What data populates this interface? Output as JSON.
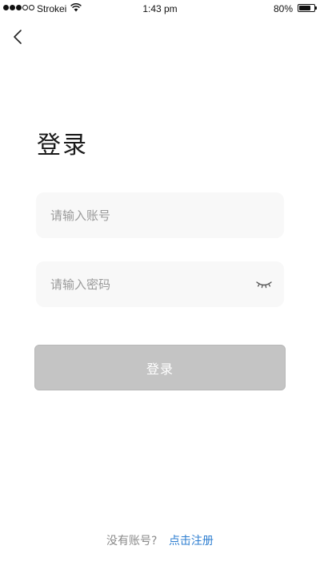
{
  "status_bar": {
    "carrier": "Strokei",
    "time": "1:43 pm",
    "battery": "80%",
    "battery_level": 0.8
  },
  "nav": {
    "back_icon": "chevron-left-icon"
  },
  "login": {
    "title": "登录",
    "account_placeholder": "请输入账号",
    "password_placeholder": "请输入密码",
    "password_toggle_icon": "eye-closed-icon",
    "submit_label": "登录",
    "button_color": "#c4c4c4"
  },
  "footer": {
    "no_account_text": "没有账号?",
    "register_link": "点击注册",
    "link_color": "#2f7fd1"
  }
}
